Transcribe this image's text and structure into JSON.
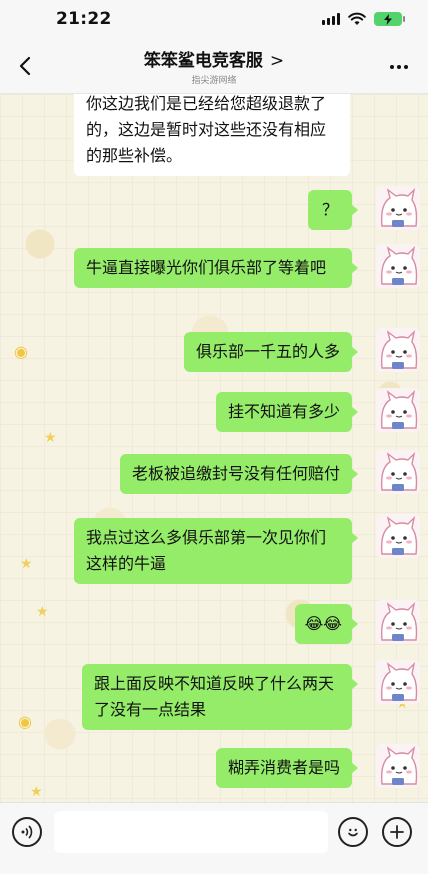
{
  "status_bar": {
    "time": "21:22"
  },
  "header": {
    "title": "笨笨鲨电竞客服",
    "title_chevron": ">",
    "subtitle": "指尖游网络"
  },
  "messages": [
    {
      "side": "in",
      "text": "你这边我们是已经给您超级退款了的，这边是暂时对这些还没有相应的那些补偿。"
    },
    {
      "side": "out",
      "text": "？"
    },
    {
      "side": "out",
      "text": "牛逼直接曝光你们俱乐部了等着吧"
    },
    {
      "side": "out",
      "text": "俱乐部一千五的人多"
    },
    {
      "side": "out",
      "text": "挂不知道有多少"
    },
    {
      "side": "out",
      "text": "老板被追缴封号没有任何赔付"
    },
    {
      "side": "out",
      "text": "我点过这么多俱乐部第一次见你们这样的牛逼"
    },
    {
      "side": "out",
      "text": "😂😂"
    },
    {
      "side": "out",
      "text": "跟上面反映不知道反映了什么两天了没有一点结果"
    },
    {
      "side": "out",
      "text": "糊弄消费者是吗"
    }
  ],
  "input": {
    "value": ""
  },
  "colors": {
    "outgoing_bubble": "#95ec69",
    "incoming_bubble": "#ffffff",
    "battery": "#52d36c"
  },
  "icons": {
    "back": "chevron-left-icon",
    "more": "more-dots-icon",
    "voice": "voice-icon",
    "emoji": "emoji-icon",
    "plus": "plus-icon",
    "avatar": "cat-avatar-icon"
  }
}
